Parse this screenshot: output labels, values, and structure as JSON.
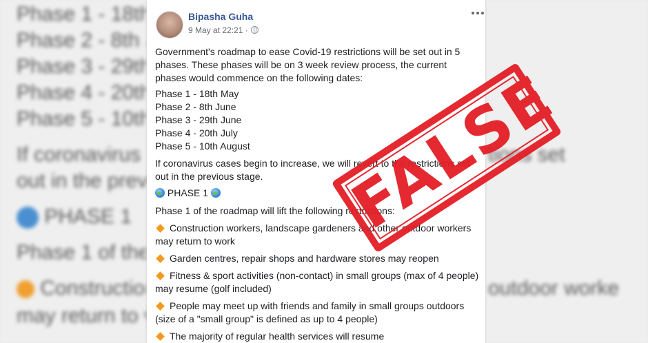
{
  "background": {
    "left_lines": [
      "Phase 1 - 18th",
      "Phase 2 - 8th J",
      "Phase 3 - 29th",
      "Phase 4 - 20th",
      "Phase 5 - 10th",
      "If coronavirus ca",
      "out in the previo",
      "PHASE 1",
      "Phase 1 of the ro",
      "Construction",
      "may return to wo"
    ],
    "right_lines": [
      "tions set",
      "outdoor worke"
    ]
  },
  "post": {
    "author": "Bipasha Guha",
    "timestamp": "9 May at 22:21 ·",
    "intro": [
      "Government's roadmap to ease Covid-19 restrictions will be set out in 5",
      "phases. These phases will be on 3 week review process, the current",
      "phases would commence on the following dates:"
    ],
    "phases": [
      "Phase 1 - 18th May",
      "Phase 2 - 8th June",
      "Phase 3 - 29th June",
      "Phase 4 - 20th July",
      "Phase 5 - 10th August"
    ],
    "revert": [
      "If coronavirus cases begin to increase, we will revert to the restrictions set",
      "out in the previous stage."
    ],
    "phase_heading": "PHASE 1",
    "phase_intro": "Phase 1 of the roadmap will lift the following restrictions:",
    "bullets": [
      [
        "Construction workers, landscape gardeners and other outdoor workers",
        "may return to work"
      ],
      [
        "Garden centres, repair shops and hardware stores may reopen"
      ],
      [
        "Fitness & sport activities (non-contact) in small groups (max of 4 people)",
        "may resume (golf included)"
      ],
      [
        "People may meet up with friends and family in small groups outdoors",
        "(size of a \"small group\" is defined as up to 4 people)"
      ],
      [
        "The majority of regular health services will resume"
      ]
    ]
  },
  "stamp": {
    "label": "FALSE",
    "color": "#e41e26"
  },
  "icons": {
    "more": "more-options-icon",
    "privacy": "globe-icon",
    "bullet": "orange-diamond-icon",
    "heading": "globe-emoji-icon"
  }
}
